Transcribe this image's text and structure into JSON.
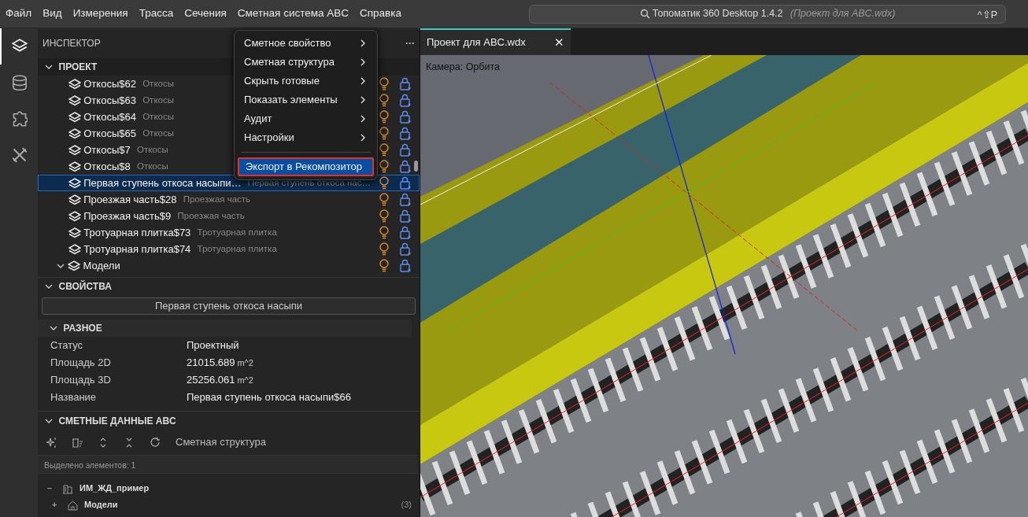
{
  "menu_bar": {
    "items": [
      "Файл",
      "Вид",
      "Измерения",
      "Трасса",
      "Сечения",
      "Сметная система ABC",
      "Справка"
    ]
  },
  "command_center": {
    "title": "Топоматик 360 Desktop 1.4.2",
    "subtitle": "(Проект для ABC.wdx)",
    "shortcut": "^⇧P"
  },
  "activity_bar": {
    "items": [
      {
        "kind": "layers",
        "selected": true
      },
      {
        "kind": "database",
        "selected": false
      },
      {
        "kind": "puzzle",
        "selected": false
      },
      {
        "kind": "tools",
        "selected": false
      }
    ]
  },
  "inspector": {
    "title": "ИНСПЕКТОР",
    "more": "···"
  },
  "project": {
    "title": "ПРОЕКТ",
    "expanded": true,
    "items": [
      {
        "kind": "item",
        "name": "Откосы$62",
        "type": "Откосы",
        "selected": false
      },
      {
        "kind": "item",
        "name": "Откосы$63",
        "type": "Откосы",
        "selected": false
      },
      {
        "kind": "item",
        "name": "Откосы$64",
        "type": "Откосы",
        "selected": false
      },
      {
        "kind": "item",
        "name": "Откосы$65",
        "type": "Откосы",
        "selected": false
      },
      {
        "kind": "item",
        "name": "Откосы$7",
        "type": "Откосы",
        "selected": false
      },
      {
        "kind": "item",
        "name": "Откосы$8",
        "type": "Откосы",
        "selected": false
      },
      {
        "kind": "item",
        "name": "Первая ступень откоса насыпи…",
        "type": "Первая ступень откоса нас…",
        "selected": true
      },
      {
        "kind": "item",
        "name": "Проезжая часть$28",
        "type": "Проезжая часть",
        "selected": false
      },
      {
        "kind": "item",
        "name": "Проезжая часть$9",
        "type": "Проезжая часть",
        "selected": false
      },
      {
        "kind": "item",
        "name": "Тротуарная плитка$73",
        "type": "Тротуарная плитка",
        "selected": false
      },
      {
        "kind": "item",
        "name": "Тротуарная плитка$74",
        "type": "Тротуарная плитка",
        "selected": false
      },
      {
        "kind": "group",
        "name": "Модели",
        "selected": false
      }
    ]
  },
  "context_menu": {
    "items": [
      {
        "kind": "submenu",
        "label": "Сметное свойство",
        "highlighted": false
      },
      {
        "kind": "submenu",
        "label": "Сметная структура",
        "highlighted": false
      },
      {
        "kind": "submenu",
        "label": "Скрыть готовые",
        "highlighted": false
      },
      {
        "kind": "submenu",
        "label": "Показать элементы",
        "highlighted": false
      },
      {
        "kind": "submenu",
        "label": "Аудит",
        "highlighted": false
      },
      {
        "kind": "submenu",
        "label": "Настройки",
        "highlighted": false
      },
      {
        "kind": "action",
        "label": "Экспорт в Рекомпозитор",
        "highlighted": true
      }
    ]
  },
  "properties": {
    "title": "СВОЙСТВА",
    "selected_name": "Первая ступень откоса насыпи",
    "group": {
      "title": "РАЗНОЕ",
      "rows": [
        {
          "label": "Статус",
          "value": "Проектный"
        },
        {
          "label": "Площадь 2D",
          "value": "21015.689",
          "unit": "m^2"
        },
        {
          "label": "Площадь 3D",
          "value": "25256.061",
          "unit": "m^2"
        },
        {
          "label": "Название",
          "value": "Первая ступень откоса насыпи$66"
        }
      ]
    }
  },
  "estimate": {
    "title": "СМЕТНЫЕ ДАННЫЕ ABC",
    "toolbar_label": "Сметная структура",
    "selection": "Выделено элементов: 1",
    "tree": [
      {
        "name": "ИМ_ЖД_пример",
        "kind": "building",
        "toggle": "–"
      },
      {
        "name": "Модели",
        "kind": "home",
        "toggle": "+",
        "count": "(3)"
      }
    ]
  },
  "document_tab": {
    "title": "Проект для ABC.wdx",
    "close": "✕"
  },
  "viewport": {
    "camera_label": "Камера: Орбита"
  }
}
